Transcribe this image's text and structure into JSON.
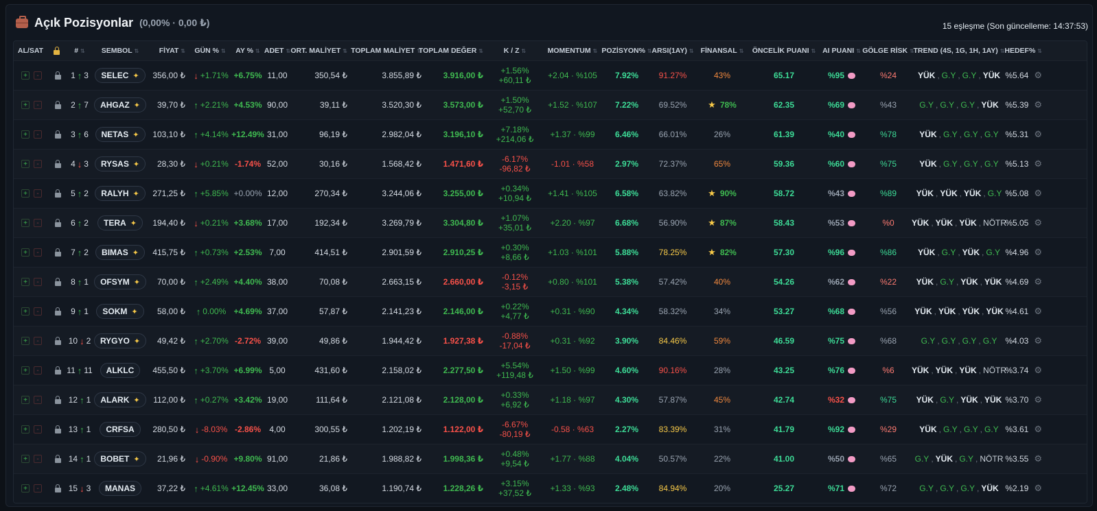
{
  "header": {
    "title": "Açık Pozisyonlar",
    "subtitle": "(0,00% · 0,00 ₺)",
    "meta": "15 eşleşme (Son güncelleme: 14:37:53)"
  },
  "columns": [
    "AL/SAT",
    "",
    "#",
    "SEMBOL",
    "FİYAT",
    "GÜN %",
    "AY %",
    "ADET",
    "ORT. MALİYET",
    "TOPLAM MALİYET",
    "TOPLAM DEĞER",
    "K / Z",
    "MOMENTUM",
    "POZİSYON%",
    "ARSI(1AY)",
    "FİNANSAL",
    "ÖNCELİK PUANI",
    "AI PUANI",
    "GÖLGE RİSK",
    "TREND (4S, 1G, 1H, 1AY)",
    "HEDEF%"
  ],
  "buttons": {
    "buy": "+",
    "sell": "-"
  },
  "icons": {
    "header": "briefcase-icon",
    "lock": "lock-icon",
    "spark": "sparkle-icon",
    "star": "star-icon",
    "brain": "brain-icon",
    "gear": "gear-icon"
  },
  "colors": {
    "green": "#3fb950",
    "red": "#f85149",
    "cyan": "#3ddc97",
    "yellow": "#f7c948",
    "orange": "#f0883e"
  },
  "rows": [
    {
      "rank": "1",
      "dir": "up",
      "chg": "3",
      "symbol": "SELEC",
      "spark": true,
      "price": "356,00 ₺",
      "dayDir": "down",
      "day": "+1.71%",
      "month": "+6.75%",
      "qty": "11,00",
      "avg": "350,54 ₺",
      "cost": "3.855,89 ₺",
      "value": "3.916,00 ₺",
      "pl": "+1.56%",
      "plAmt": "+60,11 ₺",
      "mom": "+2.04 · %105",
      "pos": "7.92%",
      "arsi": "91.27%",
      "fin": "43%",
      "finStar": false,
      "prio": "65.17",
      "ai": "%95",
      "shadow": "%24",
      "trend": [
        [
          "YÜK",
          "w"
        ],
        [
          "G.Y",
          "g"
        ],
        [
          "G.Y",
          "g"
        ],
        [
          "YÜK",
          "w"
        ]
      ],
      "target": "%5.64",
      "sc": {
        "pl": "g",
        "day": "g",
        "month": "g",
        "value": "g",
        "mom": "g",
        "arsi": "rd",
        "fin": "o",
        "ai": "cy",
        "shadow": "pk"
      }
    },
    {
      "rank": "2",
      "dir": "up",
      "chg": "7",
      "symbol": "AHGAZ",
      "spark": true,
      "price": "39,70 ₺",
      "dayDir": "up",
      "day": "+2.21%",
      "month": "+4.53%",
      "qty": "90,00",
      "avg": "39,11 ₺",
      "cost": "3.520,30 ₺",
      "value": "3.573,00 ₺",
      "pl": "+1.50%",
      "plAmt": "+52,70 ₺",
      "mom": "+1.52 · %107",
      "pos": "7.22%",
      "arsi": "69.52%",
      "fin": "78%",
      "finStar": true,
      "prio": "62.35",
      "ai": "%69",
      "shadow": "%43",
      "trend": [
        [
          "G.Y",
          "g"
        ],
        [
          "G.Y",
          "g"
        ],
        [
          "G.Y",
          "g"
        ],
        [
          "YÜK",
          "w"
        ]
      ],
      "target": "%5.39",
      "sc": {
        "pl": "g",
        "day": "g",
        "month": "g",
        "value": "g",
        "mom": "g",
        "arsi": "mute",
        "fin": "g",
        "ai": "cy",
        "shadow": "mute"
      }
    },
    {
      "rank": "3",
      "dir": "up",
      "chg": "6",
      "symbol": "NETAS",
      "spark": true,
      "price": "103,10 ₺",
      "dayDir": "up",
      "day": "+4.14%",
      "month": "+12.49%",
      "qty": "31,00",
      "avg": "96,19 ₺",
      "cost": "2.982,04 ₺",
      "value": "3.196,10 ₺",
      "pl": "+7.18%",
      "plAmt": "+214,06 ₺",
      "mom": "+1.37 · %99",
      "pos": "6.46%",
      "arsi": "66.01%",
      "fin": "26%",
      "finStar": false,
      "prio": "61.39",
      "ai": "%40",
      "shadow": "%78",
      "trend": [
        [
          "YÜK",
          "w"
        ],
        [
          "G.Y",
          "g"
        ],
        [
          "G.Y",
          "g"
        ],
        [
          "G.Y",
          "g"
        ]
      ],
      "target": "%5.31",
      "sc": {
        "pl": "g",
        "day": "g",
        "month": "g",
        "value": "g",
        "mom": "g",
        "arsi": "mute",
        "fin": "mute",
        "ai": "cy",
        "shadow": "cy"
      }
    },
    {
      "rank": "4",
      "dir": "down",
      "chg": "3",
      "symbol": "RYSAS",
      "spark": true,
      "price": "28,30 ₺",
      "dayDir": "down",
      "day": "+0.21%",
      "month": "-1.74%",
      "qty": "52,00",
      "avg": "30,16 ₺",
      "cost": "1.568,42 ₺",
      "value": "1.471,60 ₺",
      "pl": "-6.17%",
      "plAmt": "-96,82 ₺",
      "mom": "-1.01 · %58",
      "pos": "2.97%",
      "arsi": "72.37%",
      "fin": "65%",
      "finStar": false,
      "prio": "59.36",
      "ai": "%60",
      "shadow": "%75",
      "trend": [
        [
          "YÜK",
          "w"
        ],
        [
          "G.Y",
          "g"
        ],
        [
          "G.Y",
          "g"
        ],
        [
          "G.Y",
          "g"
        ]
      ],
      "target": "%5.13",
      "sc": {
        "pl": "rd",
        "day": "g",
        "month": "rd",
        "value": "rd",
        "mom": "rd",
        "arsi": "mute",
        "fin": "o",
        "ai": "cy",
        "shadow": "cy"
      }
    },
    {
      "rank": "5",
      "dir": "up",
      "chg": "2",
      "symbol": "RALYH",
      "spark": true,
      "price": "271,25 ₺",
      "dayDir": "up",
      "day": "+5.85%",
      "month": "+0.00%",
      "qty": "12,00",
      "avg": "270,34 ₺",
      "cost": "3.244,06 ₺",
      "value": "3.255,00 ₺",
      "pl": "+0.34%",
      "plAmt": "+10,94 ₺",
      "mom": "+1.41 · %105",
      "pos": "6.58%",
      "arsi": "63.82%",
      "fin": "90%",
      "finStar": true,
      "prio": "58.72",
      "ai": "%43",
      "shadow": "%89",
      "trend": [
        [
          "YÜK",
          "w"
        ],
        [
          "YÜK",
          "w"
        ],
        [
          "YÜK",
          "w"
        ],
        [
          "G.Y",
          "g"
        ]
      ],
      "target": "%5.08",
      "sc": {
        "pl": "g",
        "day": "g",
        "month": "mute",
        "value": "g",
        "mom": "g",
        "arsi": "mute",
        "fin": "g",
        "ai": "mute",
        "shadow": "cy"
      }
    },
    {
      "rank": "6",
      "dir": "up",
      "chg": "2",
      "symbol": "TERA",
      "spark": true,
      "price": "194,40 ₺",
      "dayDir": "down",
      "day": "+0.21%",
      "month": "+3.68%",
      "qty": "17,00",
      "avg": "192,34 ₺",
      "cost": "3.269,79 ₺",
      "value": "3.304,80 ₺",
      "pl": "+1.07%",
      "plAmt": "+35,01 ₺",
      "mom": "+2.20 · %97",
      "pos": "6.68%",
      "arsi": "56.90%",
      "fin": "87%",
      "finStar": true,
      "prio": "58.43",
      "ai": "%53",
      "shadow": "%0",
      "trend": [
        [
          "YÜK",
          "w"
        ],
        [
          "YÜK",
          "w"
        ],
        [
          "YÜK",
          "w"
        ],
        [
          "NÖTR",
          "n"
        ]
      ],
      "target": "%5.05",
      "sc": {
        "pl": "g",
        "day": "g",
        "month": "g",
        "value": "g",
        "mom": "g",
        "arsi": "mute",
        "fin": "g",
        "ai": "mute",
        "shadow": "pk"
      }
    },
    {
      "rank": "7",
      "dir": "up",
      "chg": "2",
      "symbol": "BIMAS",
      "spark": true,
      "price": "415,75 ₺",
      "dayDir": "up",
      "day": "+0.73%",
      "month": "+2.53%",
      "qty": "7,00",
      "avg": "414,51 ₺",
      "cost": "2.901,59 ₺",
      "value": "2.910,25 ₺",
      "pl": "+0.30%",
      "plAmt": "+8,66 ₺",
      "mom": "+1.03 · %101",
      "pos": "5.88%",
      "arsi": "78.25%",
      "fin": "82%",
      "finStar": true,
      "prio": "57.30",
      "ai": "%96",
      "shadow": "%86",
      "trend": [
        [
          "YÜK",
          "w"
        ],
        [
          "G.Y",
          "g"
        ],
        [
          "YÜK",
          "w"
        ],
        [
          "G.Y",
          "g"
        ]
      ],
      "target": "%4.96",
      "sc": {
        "pl": "g",
        "day": "g",
        "month": "g",
        "value": "g",
        "mom": "g",
        "arsi": "y",
        "fin": "g",
        "ai": "cy",
        "shadow": "cy"
      }
    },
    {
      "rank": "8",
      "dir": "up",
      "chg": "1",
      "symbol": "OFSYM",
      "spark": true,
      "price": "70,00 ₺",
      "dayDir": "up",
      "day": "+2.49%",
      "month": "+4.40%",
      "qty": "38,00",
      "avg": "70,08 ₺",
      "cost": "2.663,15 ₺",
      "value": "2.660,00 ₺",
      "pl": "-0.12%",
      "plAmt": "-3,15 ₺",
      "mom": "+0.80 · %101",
      "pos": "5.38%",
      "arsi": "57.42%",
      "fin": "40%",
      "finStar": false,
      "prio": "54.26",
      "ai": "%62",
      "shadow": "%22",
      "trend": [
        [
          "YÜK",
          "w"
        ],
        [
          "G.Y",
          "g"
        ],
        [
          "YÜK",
          "w"
        ],
        [
          "YÜK",
          "w"
        ]
      ],
      "target": "%4.69",
      "sc": {
        "pl": "rd",
        "day": "g",
        "month": "g",
        "value": "rd",
        "mom": "g",
        "arsi": "mute",
        "fin": "o",
        "ai": "mute",
        "shadow": "pk"
      }
    },
    {
      "rank": "9",
      "dir": "up",
      "chg": "1",
      "symbol": "SOKM",
      "spark": true,
      "price": "58,00 ₺",
      "dayDir": "up",
      "day": "0.00%",
      "month": "+4.69%",
      "qty": "37,00",
      "avg": "57,87 ₺",
      "cost": "2.141,23 ₺",
      "value": "2.146,00 ₺",
      "pl": "+0.22%",
      "plAmt": "+4,77 ₺",
      "mom": "+0.31 · %90",
      "pos": "4.34%",
      "arsi": "58.32%",
      "fin": "34%",
      "finStar": false,
      "prio": "53.27",
      "ai": "%68",
      "shadow": "%56",
      "trend": [
        [
          "YÜK",
          "w"
        ],
        [
          "YÜK",
          "w"
        ],
        [
          "YÜK",
          "w"
        ],
        [
          "YÜK",
          "w"
        ]
      ],
      "target": "%4.61",
      "sc": {
        "pl": "g",
        "day": "g",
        "month": "g",
        "value": "g",
        "mom": "g",
        "arsi": "mute",
        "fin": "mute",
        "ai": "cy",
        "shadow": "mute"
      }
    },
    {
      "rank": "10",
      "dir": "down",
      "chg": "2",
      "symbol": "RYGYO",
      "spark": true,
      "price": "49,42 ₺",
      "dayDir": "up",
      "day": "+2.70%",
      "month": "-2.72%",
      "qty": "39,00",
      "avg": "49,86 ₺",
      "cost": "1.944,42 ₺",
      "value": "1.927,38 ₺",
      "pl": "-0.88%",
      "plAmt": "-17,04 ₺",
      "mom": "+0.31 · %92",
      "pos": "3.90%",
      "arsi": "84.46%",
      "fin": "59%",
      "finStar": false,
      "prio": "46.59",
      "ai": "%75",
      "shadow": "%68",
      "trend": [
        [
          "G.Y",
          "g"
        ],
        [
          "G.Y",
          "g"
        ],
        [
          "G.Y",
          "g"
        ],
        [
          "G.Y",
          "g"
        ]
      ],
      "target": "%4.03",
      "sc": {
        "pl": "rd",
        "day": "g",
        "month": "rd",
        "value": "rd",
        "mom": "g",
        "arsi": "y",
        "fin": "o",
        "ai": "cy",
        "shadow": "mute"
      }
    },
    {
      "rank": "11",
      "dir": "up",
      "chg": "11",
      "symbol": "ALKLC",
      "spark": false,
      "price": "455,50 ₺",
      "dayDir": "up",
      "day": "+3.70%",
      "month": "+6.99%",
      "qty": "5,00",
      "avg": "431,60 ₺",
      "cost": "2.158,02 ₺",
      "value": "2.277,50 ₺",
      "pl": "+5.54%",
      "plAmt": "+119,48 ₺",
      "mom": "+1.50 · %99",
      "pos": "4.60%",
      "arsi": "90.16%",
      "fin": "28%",
      "finStar": false,
      "prio": "43.25",
      "ai": "%76",
      "shadow": "%6",
      "trend": [
        [
          "YÜK",
          "w"
        ],
        [
          "YÜK",
          "w"
        ],
        [
          "YÜK",
          "w"
        ],
        [
          "NÖTR",
          "n"
        ]
      ],
      "target": "%3.74",
      "sc": {
        "pl": "g",
        "day": "g",
        "month": "g",
        "value": "g",
        "mom": "g",
        "arsi": "rd",
        "fin": "mute",
        "ai": "cy",
        "shadow": "pk"
      }
    },
    {
      "rank": "12",
      "dir": "up",
      "chg": "1",
      "symbol": "ALARK",
      "spark": true,
      "price": "112,00 ₺",
      "dayDir": "up",
      "day": "+0.27%",
      "month": "+3.42%",
      "qty": "19,00",
      "avg": "111,64 ₺",
      "cost": "2.121,08 ₺",
      "value": "2.128,00 ₺",
      "pl": "+0.33%",
      "plAmt": "+6,92 ₺",
      "mom": "+1.18 · %97",
      "pos": "4.30%",
      "arsi": "57.87%",
      "fin": "45%",
      "finStar": false,
      "prio": "42.74",
      "ai": "%32",
      "shadow": "%75",
      "trend": [
        [
          "YÜK",
          "w"
        ],
        [
          "G.Y",
          "g"
        ],
        [
          "YÜK",
          "w"
        ],
        [
          "YÜK",
          "w"
        ]
      ],
      "target": "%3.70",
      "sc": {
        "pl": "g",
        "day": "g",
        "month": "g",
        "value": "g",
        "mom": "g",
        "arsi": "mute",
        "fin": "o",
        "ai": "rd",
        "shadow": "cy"
      }
    },
    {
      "rank": "13",
      "dir": "up",
      "chg": "1",
      "symbol": "CRFSA",
      "spark": false,
      "price": "280,50 ₺",
      "dayDir": "down",
      "day": "-8.03%",
      "month": "-2.86%",
      "qty": "4,00",
      "avg": "300,55 ₺",
      "cost": "1.202,19 ₺",
      "value": "1.122,00 ₺",
      "pl": "-6.67%",
      "plAmt": "-80,19 ₺",
      "mom": "-0.58 · %63",
      "pos": "2.27%",
      "arsi": "83.39%",
      "fin": "31%",
      "finStar": false,
      "prio": "41.79",
      "ai": "%92",
      "shadow": "%29",
      "trend": [
        [
          "YÜK",
          "w"
        ],
        [
          "G.Y",
          "g"
        ],
        [
          "G.Y",
          "g"
        ],
        [
          "G.Y",
          "g"
        ]
      ],
      "target": "%3.61",
      "sc": {
        "pl": "rd",
        "day": "rd",
        "month": "rd",
        "value": "rd",
        "mom": "rd",
        "arsi": "y",
        "fin": "mute",
        "ai": "cy",
        "shadow": "pk"
      }
    },
    {
      "rank": "14",
      "dir": "up",
      "chg": "1",
      "symbol": "BOBET",
      "spark": true,
      "price": "21,96 ₺",
      "dayDir": "down",
      "day": "-0.90%",
      "month": "+9.80%",
      "qty": "91,00",
      "avg": "21,86 ₺",
      "cost": "1.988,82 ₺",
      "value": "1.998,36 ₺",
      "pl": "+0.48%",
      "plAmt": "+9,54 ₺",
      "mom": "+1.77 · %88",
      "pos": "4.04%",
      "arsi": "50.57%",
      "fin": "22%",
      "finStar": false,
      "prio": "41.00",
      "ai": "%50",
      "shadow": "%65",
      "trend": [
        [
          "G.Y",
          "g"
        ],
        [
          "YÜK",
          "w"
        ],
        [
          "G.Y",
          "g"
        ],
        [
          "NÖTR",
          "n"
        ]
      ],
      "target": "%3.55",
      "sc": {
        "pl": "g",
        "day": "rd",
        "month": "g",
        "value": "g",
        "mom": "g",
        "arsi": "mute",
        "fin": "mute",
        "ai": "mute",
        "shadow": "mute"
      }
    },
    {
      "rank": "15",
      "dir": "down",
      "chg": "3",
      "symbol": "MANAS",
      "spark": false,
      "price": "37,22 ₺",
      "dayDir": "up",
      "day": "+4.61%",
      "month": "+12.45%",
      "qty": "33,00",
      "avg": "36,08 ₺",
      "cost": "1.190,74 ₺",
      "value": "1.228,26 ₺",
      "pl": "+3.15%",
      "plAmt": "+37,52 ₺",
      "mom": "+1.33 · %93",
      "pos": "2.48%",
      "arsi": "84.94%",
      "fin": "20%",
      "finStar": false,
      "prio": "25.27",
      "ai": "%71",
      "shadow": "%72",
      "trend": [
        [
          "G.Y",
          "g"
        ],
        [
          "G.Y",
          "g"
        ],
        [
          "G.Y",
          "g"
        ],
        [
          "YÜK",
          "w"
        ]
      ],
      "target": "%2.19",
      "sc": {
        "pl": "g",
        "day": "g",
        "month": "g",
        "value": "g",
        "mom": "g",
        "arsi": "y",
        "fin": "mute",
        "ai": "cy",
        "shadow": "mute"
      }
    }
  ]
}
